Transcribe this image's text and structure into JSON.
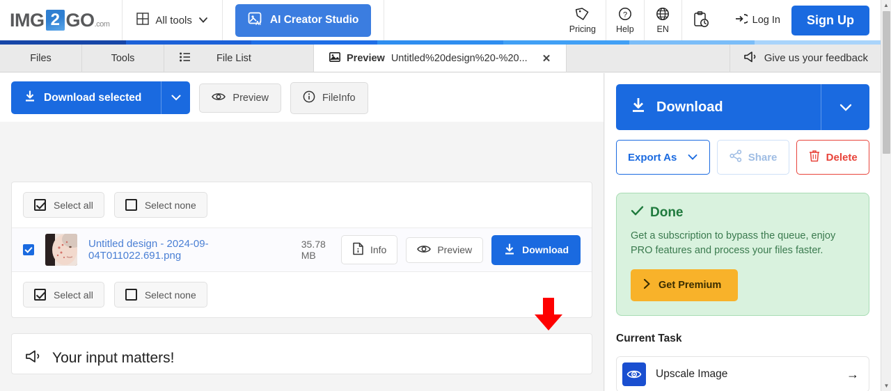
{
  "header": {
    "logo": {
      "img": "IMG",
      "two": "2",
      "go": "GO",
      "com": ".com"
    },
    "all_tools": "All tools",
    "ai_studio": "AI Creator Studio",
    "pricing": "Pricing",
    "help": "Help",
    "language": "EN",
    "login": "Log In",
    "signup": "Sign Up"
  },
  "progress_segments": [
    "#1746a8",
    "#1c61d8",
    "#1f6ee6",
    "#2f8ef0",
    "#41a0f5",
    "#7bbdf8",
    "#a9d4fb"
  ],
  "tabs": {
    "files": "Files",
    "tools": "Tools",
    "file_list": "File List",
    "preview_label": "Preview",
    "preview_name": "Untitled%20design%20-%20...",
    "close": "✕",
    "feedback": "Give us your feedback"
  },
  "toolbar": {
    "download_selected": "Download selected",
    "preview": "Preview",
    "fileinfo": "FileInfo"
  },
  "file_panel": {
    "select_all": "Select all",
    "select_none": "Select none",
    "file": {
      "name": "Untitled design - 2024-09-04T011022.691.png",
      "size": "35.78 MB",
      "info": "Info",
      "preview": "Preview",
      "download": "Download"
    }
  },
  "input_panel": {
    "title": "Your input matters!"
  },
  "sidebar": {
    "download": "Download",
    "export_as": "Export As",
    "share": "Share",
    "delete": "Delete",
    "done": {
      "title": "Done",
      "text": "Get a subscription to bypass the queue, enjoy PRO features and process your files faster.",
      "premium": "Get Premium"
    },
    "current_task_title": "Current Task",
    "task": {
      "label": "Upscale Image",
      "arrow": "→"
    }
  },
  "colors": {
    "primary_blue": "#1a6ae0",
    "ai_blue": "#3b7de0",
    "done_green_bg": "#d9f2de",
    "done_green_text": "#1f7a3d",
    "premium_orange": "#f8b22a",
    "delete_red": "#e8433a",
    "annotation_red": "#fe0000"
  }
}
